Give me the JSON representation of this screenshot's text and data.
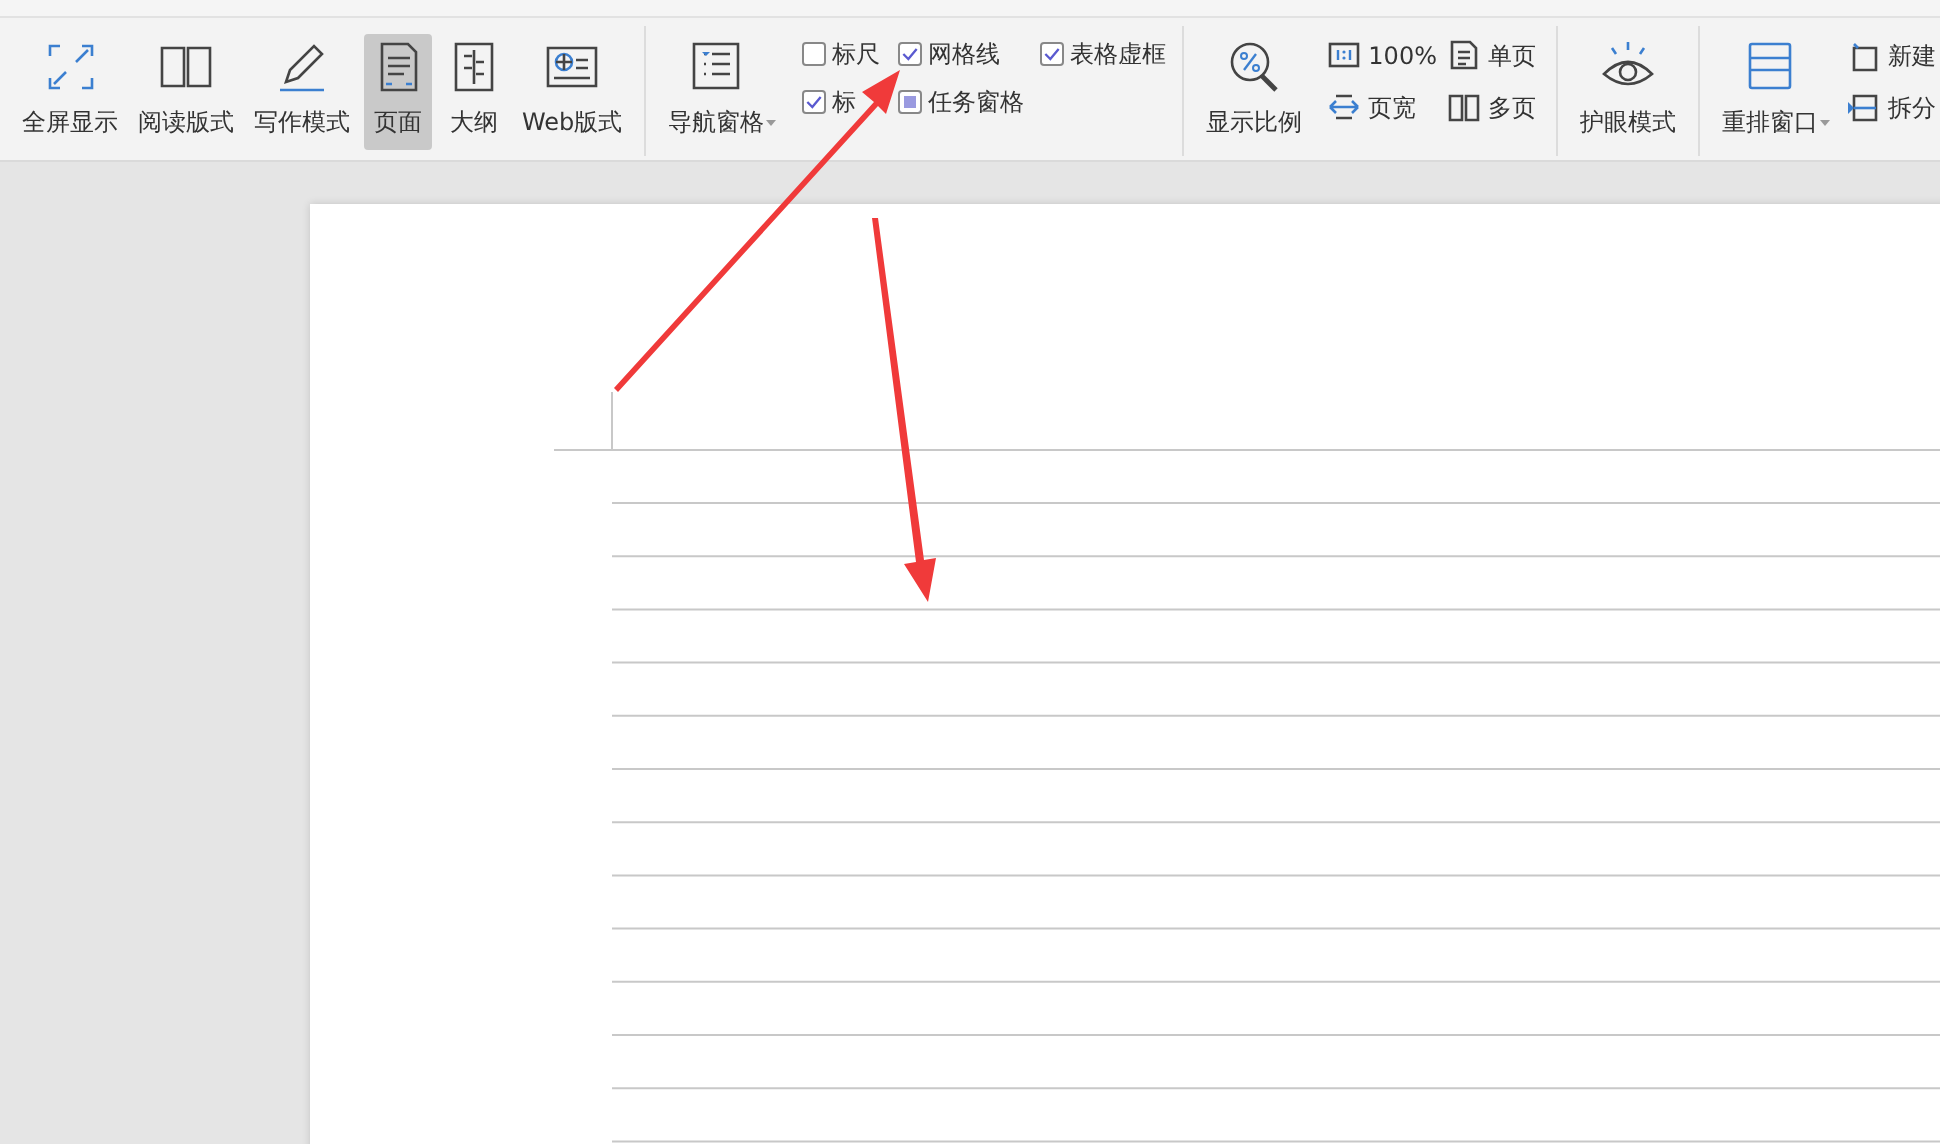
{
  "toolbar": {
    "view_modes": [
      {
        "label": "全屏显示",
        "selected": false
      },
      {
        "label": "阅读版式",
        "selected": false
      },
      {
        "label": "写作模式",
        "selected": false
      },
      {
        "label": "页面",
        "selected": true
      },
      {
        "label": "大纲",
        "selected": false
      },
      {
        "label": "Web版式",
        "selected": false
      }
    ],
    "nav_pane": {
      "label": "导航窗格"
    },
    "checkboxes": [
      {
        "label": "标尺",
        "checked": false,
        "indeterminate": false
      },
      {
        "label": "网格线",
        "checked": true,
        "indeterminate": false
      },
      {
        "label": "表格虚框",
        "checked": true,
        "indeterminate": false
      },
      {
        "label": "标",
        "checked": true,
        "indeterminate": false
      },
      {
        "label": "任务窗格",
        "checked": false,
        "indeterminate": true
      }
    ],
    "zoom": {
      "label": "显示比例"
    },
    "zoom_options": [
      {
        "label": "100%"
      },
      {
        "label": "页宽"
      },
      {
        "label": "单页"
      },
      {
        "label": "多页"
      }
    ],
    "eye_mode": {
      "label": "护眼模式"
    },
    "arrange": {
      "label": "重排窗口"
    },
    "window_options": [
      {
        "label": "新建"
      },
      {
        "label": "拆分"
      }
    ]
  }
}
